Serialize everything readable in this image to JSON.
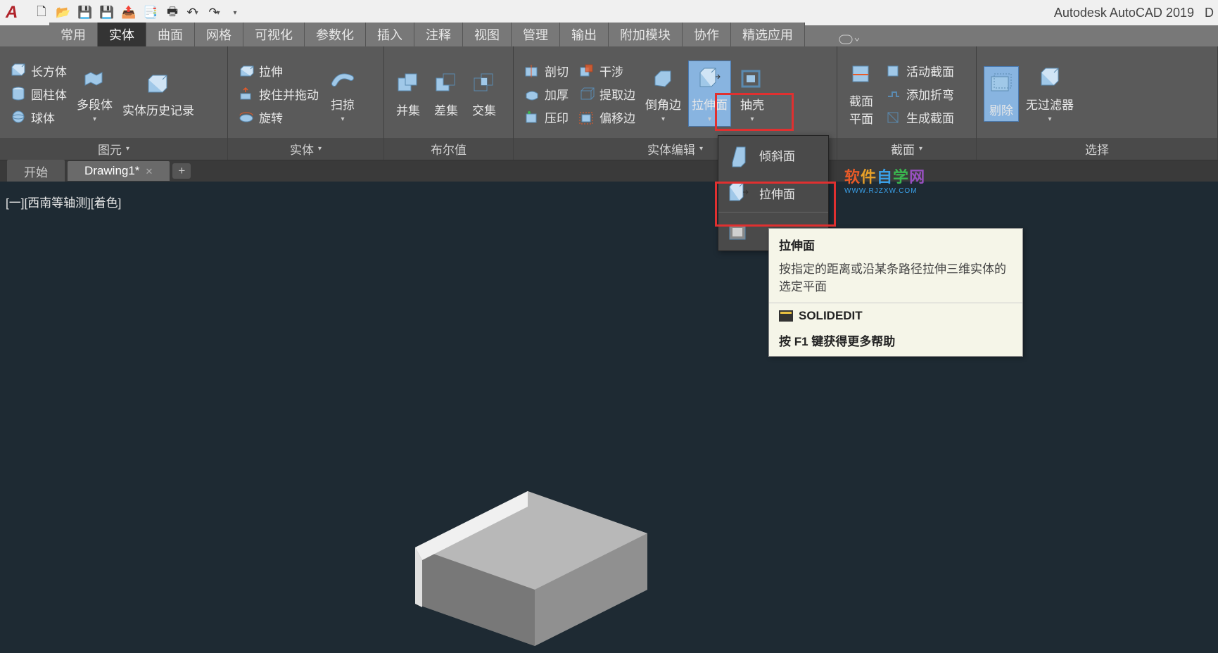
{
  "app": {
    "title": "Autodesk AutoCAD 2019",
    "title_suffix": "D"
  },
  "qat": [
    {
      "icon": "new",
      "glyph": "🗋"
    },
    {
      "icon": "open",
      "glyph": "📂"
    },
    {
      "icon": "save",
      "glyph": "💾"
    },
    {
      "icon": "saveas",
      "glyph": "💾"
    },
    {
      "icon": "export",
      "glyph": "📤"
    },
    {
      "icon": "plot",
      "glyph": "📑"
    },
    {
      "icon": "print",
      "glyph": "🖶"
    },
    {
      "icon": "undo",
      "glyph": "↶"
    },
    {
      "icon": "redo",
      "glyph": "↷"
    }
  ],
  "tabs": [
    {
      "id": "home",
      "label": "常用"
    },
    {
      "id": "solid",
      "label": "实体",
      "active": true
    },
    {
      "id": "surface",
      "label": "曲面"
    },
    {
      "id": "mesh",
      "label": "网格"
    },
    {
      "id": "visualize",
      "label": "可视化"
    },
    {
      "id": "parametric",
      "label": "参数化"
    },
    {
      "id": "insert",
      "label": "插入"
    },
    {
      "id": "annotate",
      "label": "注释"
    },
    {
      "id": "view",
      "label": "视图"
    },
    {
      "id": "manage",
      "label": "管理"
    },
    {
      "id": "output",
      "label": "输出"
    },
    {
      "id": "addins",
      "label": "附加模块"
    },
    {
      "id": "collaborate",
      "label": "协作"
    },
    {
      "id": "featured",
      "label": "精选应用"
    }
  ],
  "panels": {
    "primitive": {
      "title": "图元",
      "box": "长方体",
      "cylinder": "圆柱体",
      "sphere": "球体",
      "polysolid": "多段体",
      "history": "实体历史记录"
    },
    "solid": {
      "title": "实体",
      "extrude": "拉伸",
      "presspull": "按住并拖动",
      "revolve": "旋转",
      "sweep": "扫掠"
    },
    "boolean": {
      "title": "布尔值",
      "union": "并集",
      "subtract": "差集",
      "intersect": "交集"
    },
    "solidedit": {
      "title": "实体编辑",
      "slice": "剖切",
      "thicken": "加厚",
      "imprint": "压印",
      "interfere": "干涉",
      "extractedges": "提取边",
      "offsetedge": "偏移边",
      "chamferedge": "倒角边",
      "extrudeface": "拉伸面",
      "shell": "抽壳"
    },
    "section": {
      "title": "截面",
      "sectionplane": "截面\n平面",
      "livesection": "活动截面",
      "addjog": "添加折弯",
      "generate": "生成截面"
    },
    "selection": {
      "title": "选择",
      "culling": "剔除",
      "nofilter": "无过滤器"
    }
  },
  "flyout": {
    "taperface": "倾斜面",
    "extrudeface": "拉伸面",
    "colorface_icon": "colorface"
  },
  "doc_tabs": {
    "start": "开始",
    "drawing": "Drawing1*"
  },
  "viewport": {
    "label": "[一][西南等轴测][着色]"
  },
  "tooltip": {
    "title": "拉伸面",
    "desc": "按指定的距离或沿某条路径拉伸三维实体的选定平面",
    "command": "SOLIDEDIT",
    "help": "按 F1 键获得更多帮助"
  },
  "watermark": {
    "text": "软件自学网",
    "url": "WWW.RJZXW.COM"
  }
}
